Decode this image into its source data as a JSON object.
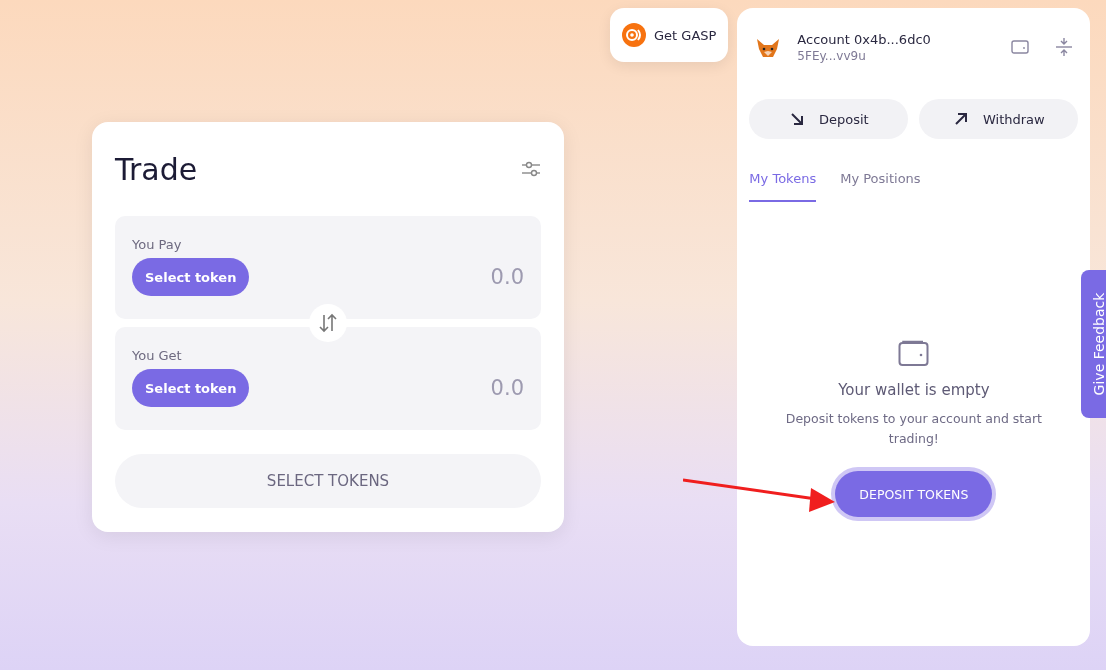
{
  "get_gasp": {
    "label": "Get GASP"
  },
  "trade": {
    "title": "Trade",
    "sections": [
      {
        "label": "You Pay",
        "button": "Select token",
        "amount": "0.0"
      },
      {
        "label": "You Get",
        "button": "Select token",
        "amount": "0.0"
      }
    ],
    "submit": "SELECT TOKENS"
  },
  "wallet": {
    "account": "Account 0x4b...6dc0",
    "address": "5FEy...vv9u",
    "actions": [
      {
        "label": "Deposit",
        "kind": "deposit"
      },
      {
        "label": "Withdraw",
        "kind": "withdraw"
      }
    ],
    "tabs": [
      {
        "label": "My Tokens",
        "selected": true
      },
      {
        "label": "My Positions",
        "selected": false
      }
    ],
    "empty": {
      "title": "Your wallet is empty",
      "text": "Deposit tokens to your account and start trading!",
      "button": "DEPOSIT TOKENS"
    }
  },
  "feedback": {
    "label": "Give Feedback"
  }
}
